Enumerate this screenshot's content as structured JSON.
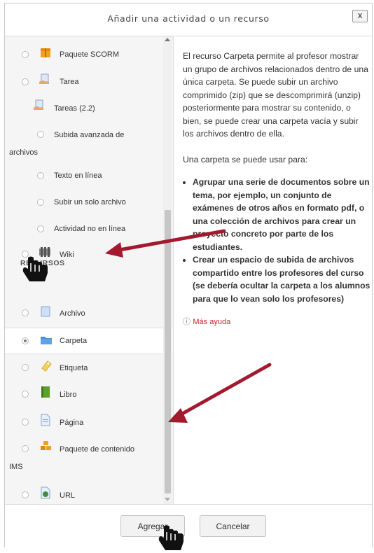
{
  "dialog": {
    "title": "Añadir una actividad o un recurso",
    "close_label": "x"
  },
  "left": {
    "items": [
      {
        "label": "Paquete SCORM",
        "icon": "scorm-package-icon"
      },
      {
        "label": "Tarea",
        "icon": "assignment-icon"
      },
      {
        "label": "Tareas (2.2)",
        "icon": "assignment-icon"
      },
      {
        "label": "Subida avanzada de",
        "label2": "archivos"
      },
      {
        "label": "Texto en línea"
      },
      {
        "label": "Subir un solo archivo"
      },
      {
        "label": "Actividad no en línea"
      },
      {
        "label": "Wiki",
        "icon": "wiki-icon"
      }
    ],
    "section_label": "RECURSOS",
    "resources": [
      {
        "label": "Archivo",
        "icon": "file-icon"
      },
      {
        "label": "Carpeta",
        "icon": "folder-icon",
        "selected": true
      },
      {
        "label": "Etiqueta",
        "icon": "label-icon"
      },
      {
        "label": "Libro",
        "icon": "book-icon"
      },
      {
        "label": "Página",
        "icon": "page-icon"
      },
      {
        "label": "Paquete de contenido",
        "label2": "IMS",
        "icon": "ims-package-icon"
      },
      {
        "label": "URL",
        "icon": "url-icon"
      }
    ]
  },
  "description": {
    "para1": "El recurso Carpeta permite al profesor mostrar un grupo de archivos relacionados dentro de una única carpeta. Se puede subir un archivo comprimido (zip) que se descomprimirá (unzip) posteriormente para mostrar su contenido, o bien, se puede crear una carpeta vacía y subir los archivos dentro de ella.",
    "para2": "Una carpeta se puede usar para:",
    "bullets": [
      "Agrupar una serie de documentos sobre un tema, por ejemplo, un conjunto de exámenes de otros años en formato pdf, o una colección de archivos para crear un proyecto concreto por parte de los estudiantes.",
      "Crear un espacio de subida de archivos compartido entre los profesores del curso (se debería ocultar la carpeta a los alumnos para que lo vean solo los profesores)"
    ],
    "more_help": "Más ayuda"
  },
  "footer": {
    "add_label": "Agregar",
    "cancel_label": "Cancelar"
  },
  "colors": {
    "arrow": "#a3192e",
    "accent": "#c1272d"
  }
}
